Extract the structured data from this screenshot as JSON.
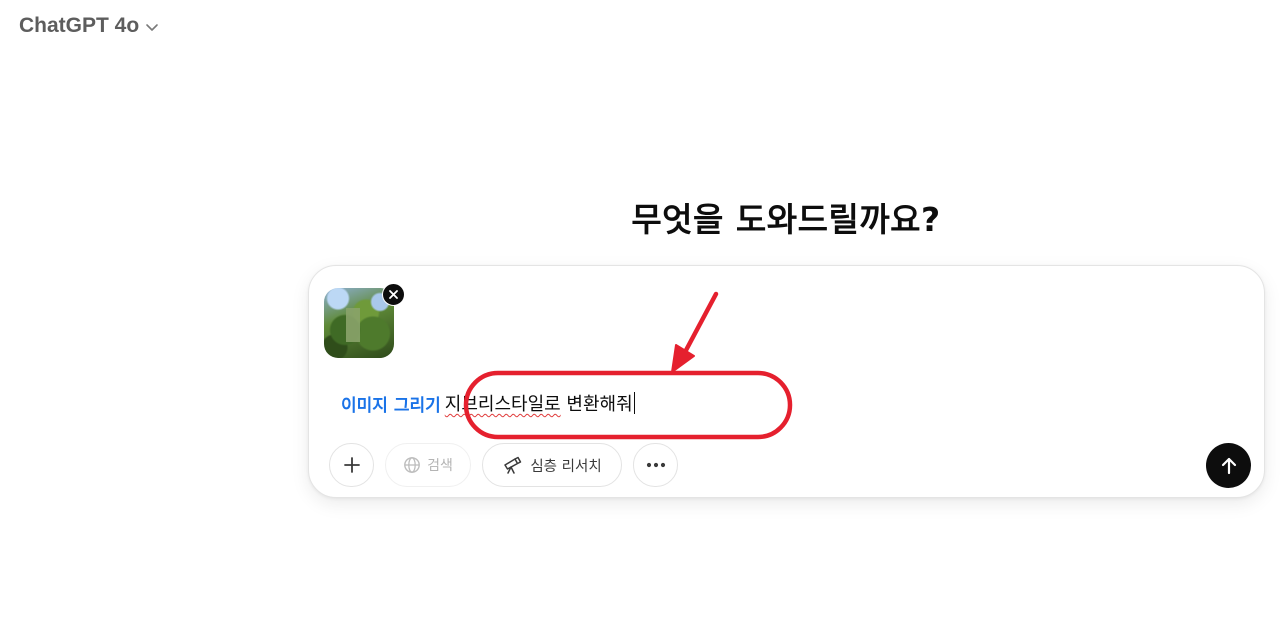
{
  "header": {
    "model_label": "ChatGPT 4o"
  },
  "main": {
    "greeting": "무엇을 도와드릴까요?"
  },
  "composer": {
    "tool_tag": "이미지 그리기",
    "typed_underlined": "지브리스타일로",
    "typed_rest": " 변환해줘",
    "search_label": "검색",
    "research_label": "심층 리서치"
  },
  "icons": {
    "model_chevron": "chevron-down-icon",
    "thumb_close": "close-icon",
    "plus": "plus-icon",
    "search": "globe-icon",
    "research": "telescope-icon",
    "more": "ellipsis-icon",
    "send": "arrow-up-icon"
  },
  "colors": {
    "tool_tag": "#1a73e8",
    "annotation": "#e5202e",
    "send_button": "#0d0d0d"
  }
}
